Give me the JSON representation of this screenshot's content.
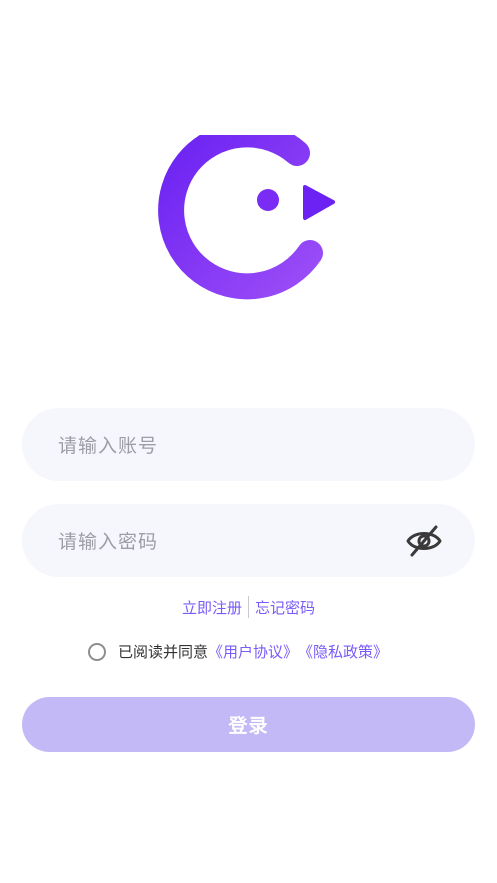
{
  "logo": {
    "icon": "g-bird-logo",
    "colors": [
      "#6b22f2",
      "#9b4df7"
    ]
  },
  "account": {
    "placeholder": "请输入账号"
  },
  "password": {
    "placeholder": "请输入密码",
    "toggle_icon": "eye-closed-icon"
  },
  "links": {
    "register": "立即注册",
    "forgot": "忘记密码"
  },
  "agreement": {
    "text": "已阅读并同意",
    "user_agreement": "《用户协议》",
    "privacy_policy": "《隐私政策》"
  },
  "login_button": {
    "label": "登录"
  },
  "colors": {
    "accent": "#7a5af8",
    "button_disabled": "#c3b9f6",
    "field_bg": "#f6f6fd",
    "placeholder": "#9d9da6"
  }
}
